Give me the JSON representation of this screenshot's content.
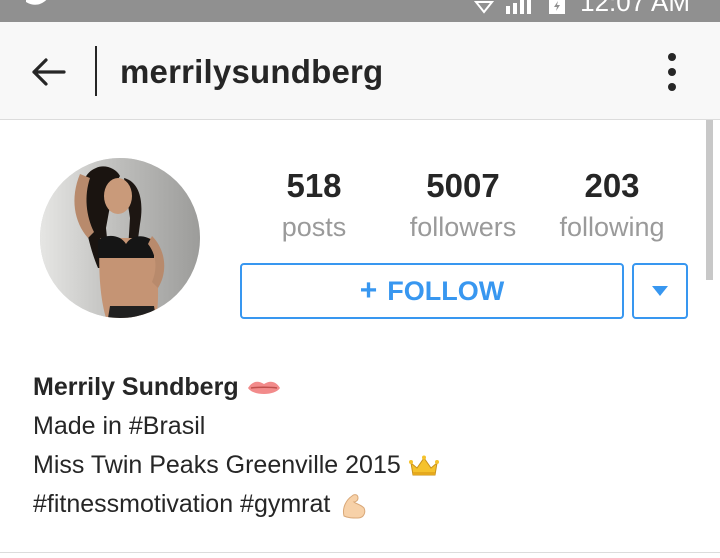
{
  "status_bar": {
    "time": "12:07 AM"
  },
  "app_bar": {
    "back_icon": "arrow-left-icon",
    "title": "merrilysundberg",
    "menu_icon": "more-vertical-icon"
  },
  "profile": {
    "avatar_alt": "profile-photo",
    "stats": [
      {
        "number": "518",
        "label": "posts"
      },
      {
        "number": "5007",
        "label": "followers"
      },
      {
        "number": "203",
        "label": "following"
      }
    ],
    "follow_button": {
      "plus": "+",
      "label": "FOLLOW"
    },
    "dropdown_icon": "caret-down-icon"
  },
  "bio": {
    "name": "Merrily Sundberg",
    "lines": [
      "Made in #Brasil",
      "Miss Twin Peaks Greenville 2015",
      "#fitnessmotivation #gymrat"
    ],
    "emojis": [
      "lips-emoji",
      "crown-emoji",
      "flexed-biceps-emoji"
    ]
  },
  "colors": {
    "accent": "#3897f0",
    "text": "#262626",
    "muted": "#9a9a9a",
    "status_bar": "#909090"
  }
}
